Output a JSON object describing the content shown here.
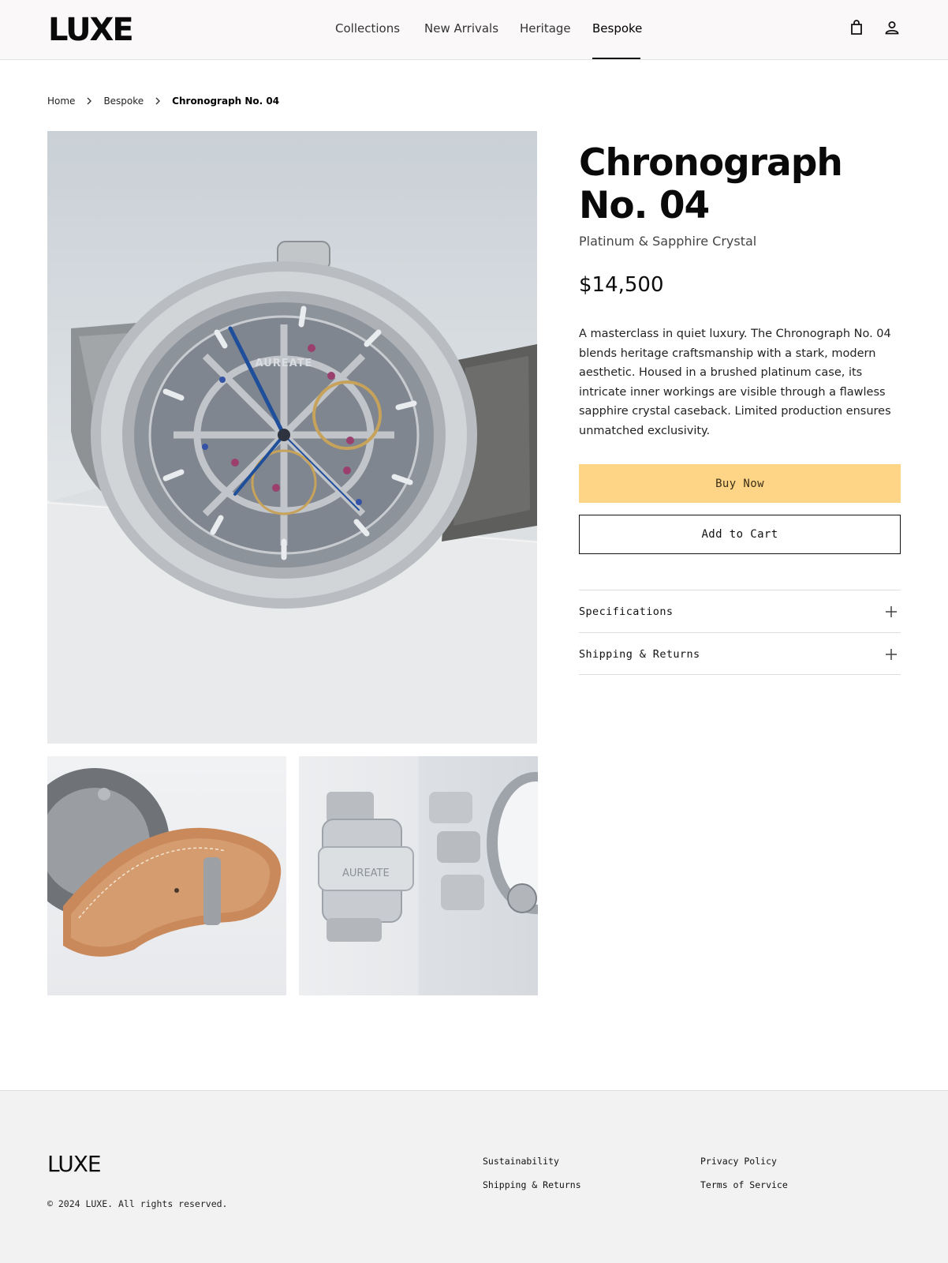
{
  "header": {
    "logo": "LUXE",
    "nav": [
      "Collections",
      "New Arrivals",
      "Heritage",
      "Bespoke"
    ],
    "active_nav": "Bespoke",
    "icons": [
      "shopping-bag-icon",
      "user-icon"
    ]
  },
  "breadcrumb": [
    "Home",
    "Bespoke",
    "Chronograph No. 04"
  ],
  "product": {
    "title": "Chronograph No. 04",
    "subtitle": "Platinum & Sapphire Crystal",
    "price": "$14,500",
    "description": "A masterclass in quiet luxury. The Chronograph No. 04 blends heritage craftsmanship with a stark, modern aesthetic. Housed in a brushed platinum case, its intricate inner workings are visible through a flawless sapphire crystal caseback. Limited production ensures unmatched exclusivity.",
    "watch_brand": "AUREATE",
    "buy_label": "Buy Now",
    "cart_label": "Add to Cart",
    "accordion": [
      "Specifications",
      "Shipping & Returns"
    ]
  },
  "colors": {
    "accent": "#fed587",
    "text": "#0a0a0a",
    "footer_bg": "#f3f2f3"
  },
  "footer": {
    "logo": "LUXE",
    "copyright": "© 2024 LUXE. All rights reserved.",
    "links_col1": [
      "Sustainability",
      "Shipping & Returns"
    ],
    "links_col2": [
      "Privacy Policy",
      "Terms of Service"
    ]
  }
}
